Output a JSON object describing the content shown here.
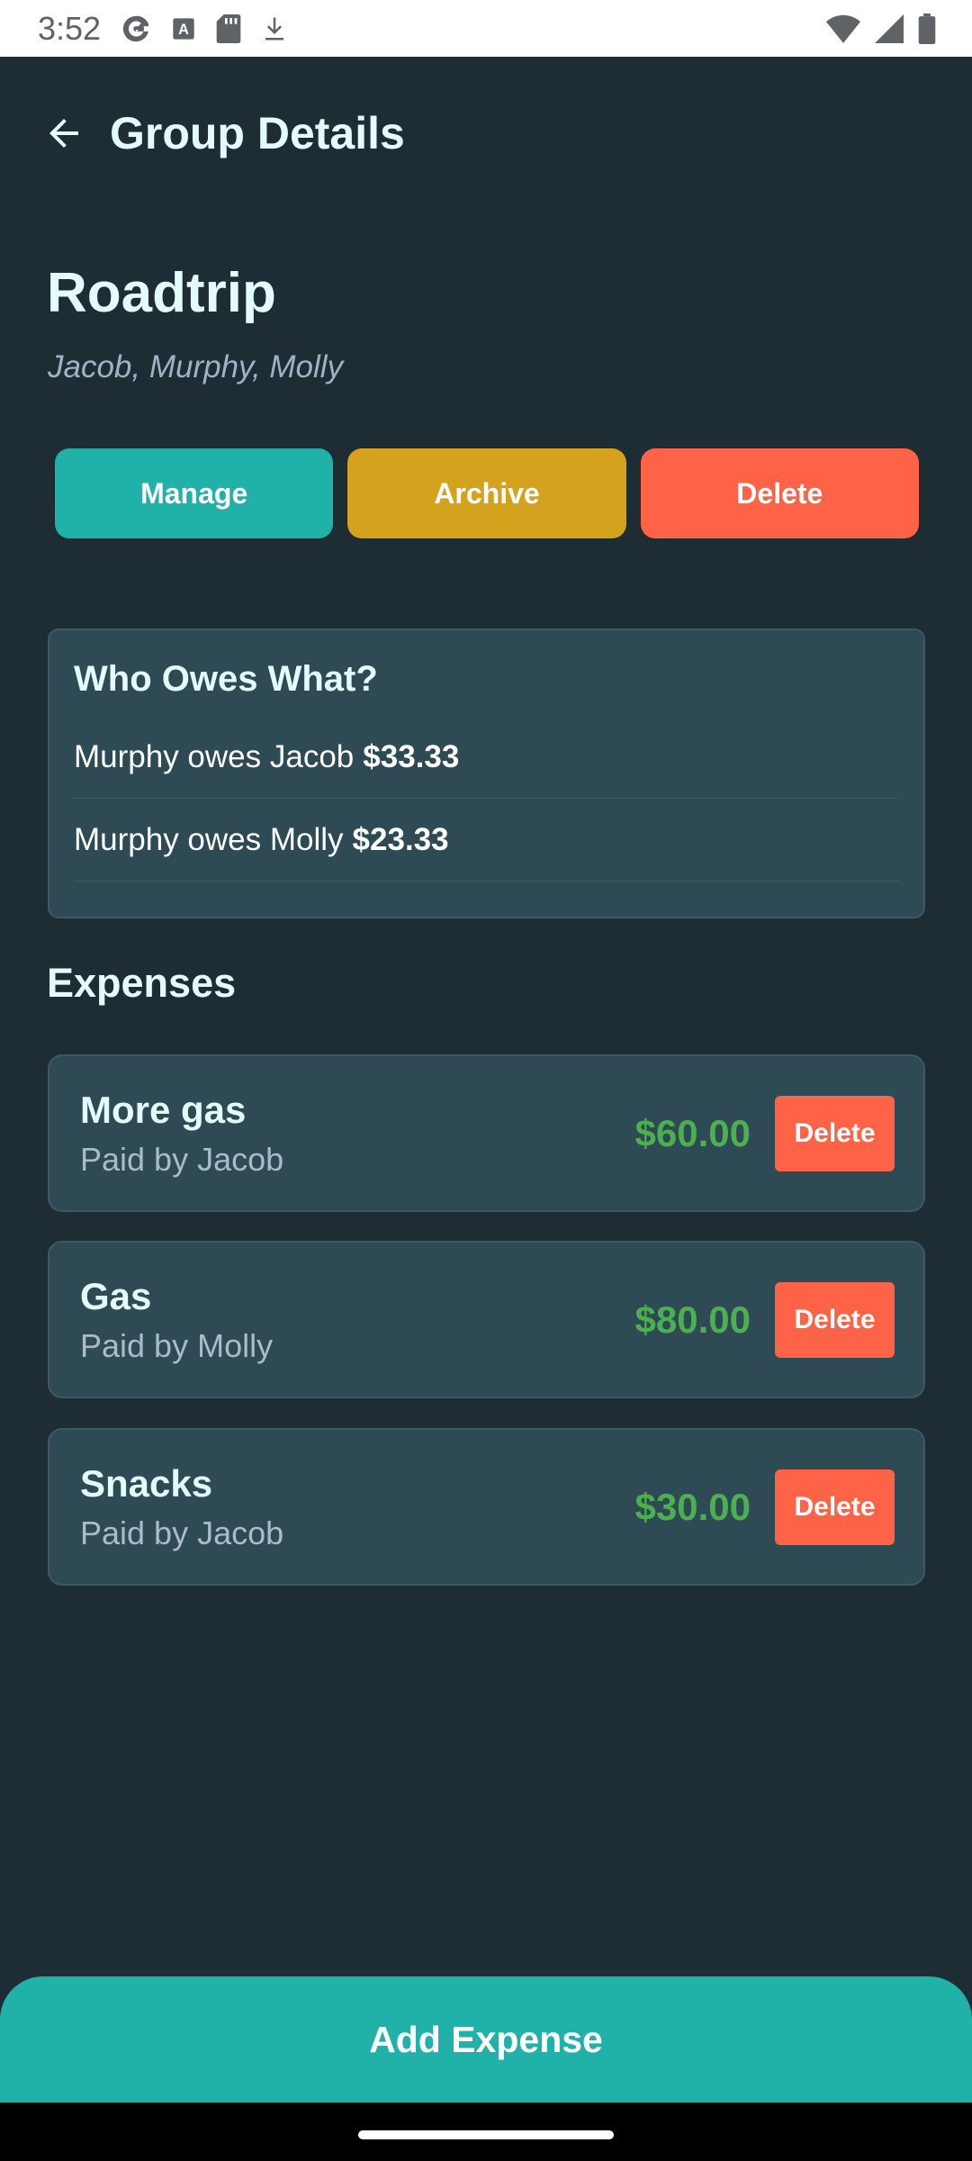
{
  "status_bar": {
    "time": "3:52",
    "icons": [
      "google-icon",
      "font-icon",
      "sd-card-icon",
      "download-icon",
      "wifi-icon",
      "signal-icon",
      "battery-icon"
    ]
  },
  "app_bar": {
    "title": "Group Details",
    "back_icon": "arrow-left-icon"
  },
  "group": {
    "name": "Roadtrip",
    "members": "Jacob, Murphy, Molly"
  },
  "actions": {
    "manage_label": "Manage",
    "archive_label": "Archive",
    "delete_label": "Delete"
  },
  "owes": {
    "title": "Who Owes What?",
    "items": [
      {
        "text": "Murphy owes Jacob",
        "amount": "$33.33"
      },
      {
        "text": "Murphy owes Molly",
        "amount": "$23.33"
      }
    ]
  },
  "expenses": {
    "title": "Expenses",
    "items": [
      {
        "name": "More gas",
        "payer": "Paid by Jacob",
        "amount": "$60.00",
        "delete_label": "Delete"
      },
      {
        "name": "Gas",
        "payer": "Paid by Molly",
        "amount": "$80.00",
        "delete_label": "Delete"
      },
      {
        "name": "Snacks",
        "payer": "Paid by Jacob",
        "amount": "$30.00",
        "delete_label": "Delete"
      }
    ]
  },
  "add_expense_label": "Add Expense",
  "colors": {
    "background": "#1e2c34",
    "card": "#2e4a54",
    "teal": "#20b2a9",
    "gold": "#d4a21c",
    "tomato": "#ff6347",
    "green_amount": "#4caf50"
  }
}
